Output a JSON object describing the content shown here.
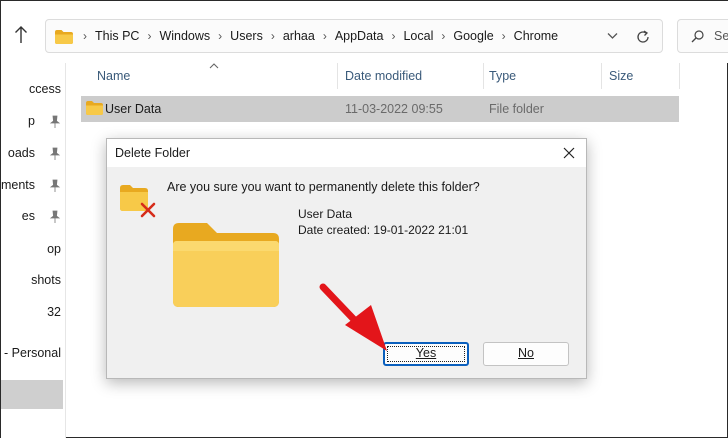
{
  "explorer": {
    "address_path": [
      "This PC",
      "Windows",
      "Users",
      "arhaa",
      "AppData",
      "Local",
      "Google",
      "Chrome"
    ],
    "search_placeholder": "Se",
    "columns": {
      "name": "Name",
      "date_modified": "Date modified",
      "type": "Type",
      "size": "Size"
    },
    "rows": [
      {
        "name": "User Data",
        "date_modified": "11-03-2022 09:55",
        "type": "File folder",
        "size": ""
      }
    ]
  },
  "sidebar": {
    "items": [
      {
        "label": "ccess",
        "pinned": false
      },
      {
        "label": "p",
        "pinned": true
      },
      {
        "label": "oads",
        "pinned": true
      },
      {
        "label": "ments",
        "pinned": true
      },
      {
        "label": "es",
        "pinned": true
      },
      {
        "label": "op",
        "pinned": false
      },
      {
        "label": "shots",
        "pinned": false
      },
      {
        "label": "32",
        "pinned": false
      },
      {
        "label": "e - Personal",
        "pinned": false
      },
      {
        "label": "",
        "pinned": false,
        "selected": true
      }
    ]
  },
  "dialog": {
    "title": "Delete Folder",
    "question": "Are you sure you want to permanently delete this folder?",
    "item_name": "User Data",
    "item_date_label": "Date created:",
    "item_date_value": "19-01-2022 21:01",
    "yes_label": "Yes",
    "no_label": "No"
  },
  "icons": {
    "up": "up-arrow-icon",
    "folder": "folder-icon",
    "pin": "pin-icon",
    "close": "close-icon",
    "warning": "folder-delete-icon",
    "search": "search-icon",
    "refresh": "refresh-icon"
  },
  "colors": {
    "accent": "#0a5fbd",
    "selection": "#cccccc",
    "folder_yellow": "#f7c948",
    "annotation_red": "#e3151a"
  }
}
